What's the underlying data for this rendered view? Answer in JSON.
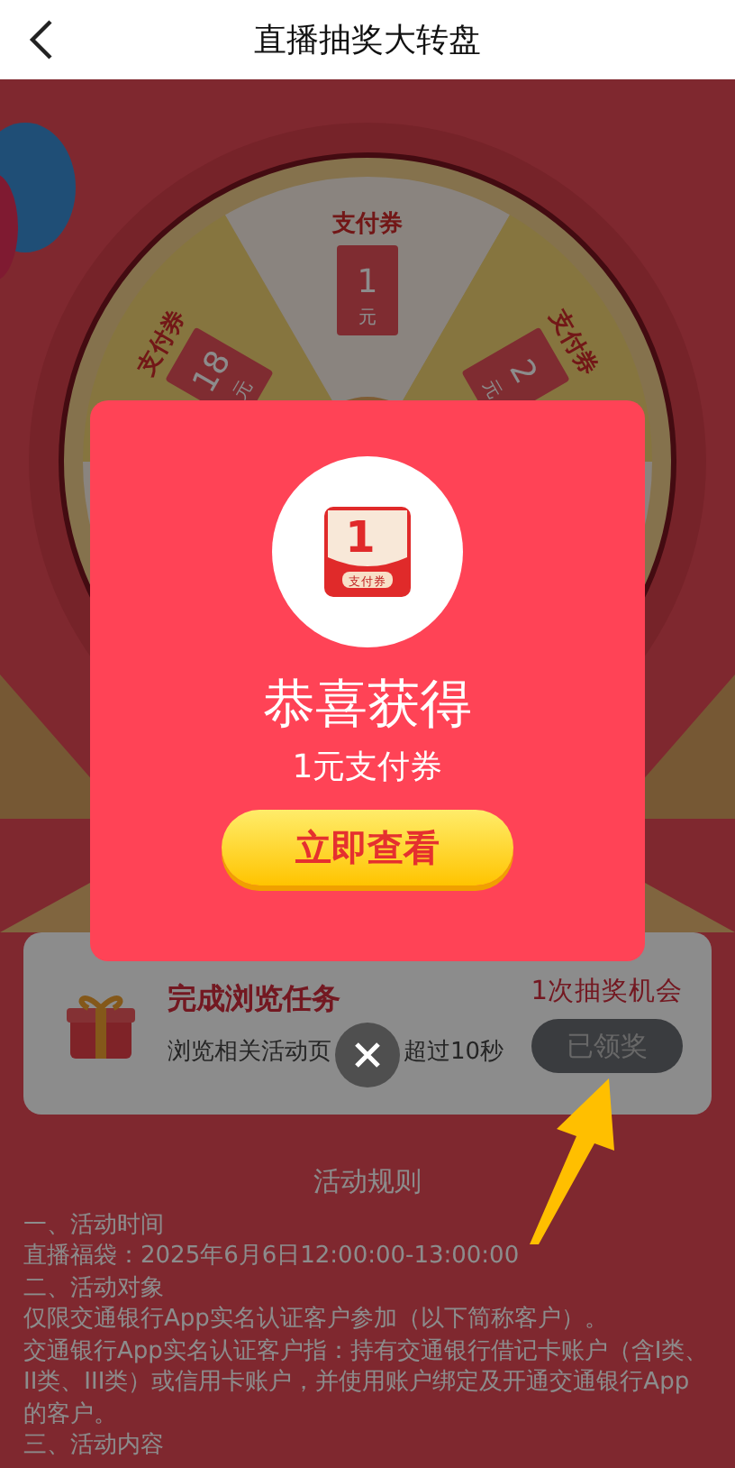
{
  "header": {
    "title": "直播抽奖大转盘"
  },
  "wheel": {
    "segments": [
      {
        "label": "支付券",
        "amount": "18",
        "unit": "元"
      },
      {
        "label": "支付券",
        "amount": "1",
        "unit": "元"
      },
      {
        "label": "支付券",
        "amount": "2",
        "unit": "元"
      }
    ]
  },
  "task": {
    "title": "完成浏览任务",
    "description": [
      "浏览相关活动页",
      "超过10秒"
    ],
    "reward": "1次抽奖机会",
    "button": {
      "label": "已领奖",
      "disabled": true
    }
  },
  "rules": {
    "title": "活动规则",
    "lines": [
      "一、活动时间",
      "直播福袋：2025年6月6日12:00:00-13:00:00",
      "二、活动对象",
      "仅限交通银行App实名认证客户参加（以下简称客户）。",
      "交通银行App实名认证客户指：持有交通银行借记卡账户（含I类、II类、III类）或信用卡账户，并使用账户绑定及开通交通银行App的客户。",
      "三、活动内容"
    ]
  },
  "dialog": {
    "prize_icon": {
      "amount": "1",
      "label": "支付券"
    },
    "title": "恭喜获得",
    "prize": "1元支付券",
    "button": "立即查看"
  }
}
